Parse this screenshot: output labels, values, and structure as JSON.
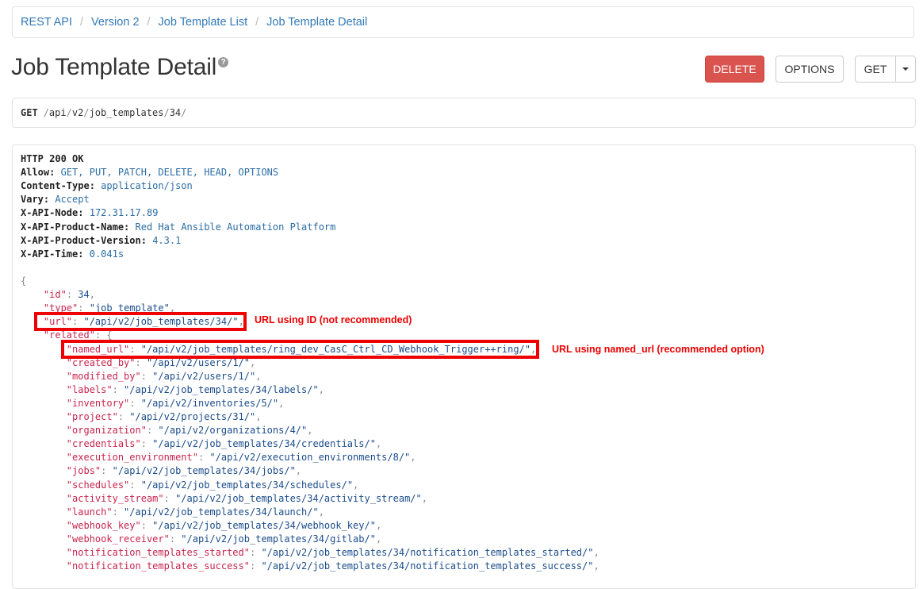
{
  "breadcrumb": [
    "REST API",
    "Version 2",
    "Job Template List",
    "Job Template Detail"
  ],
  "page": {
    "title": "Job Template Detail",
    "help_glyph": "?"
  },
  "toolbar": {
    "delete_label": "DELETE",
    "options_label": "OPTIONS",
    "get_label": "GET"
  },
  "request": {
    "method": "GET",
    "path_segments": [
      "api",
      "v2",
      "job_templates",
      "34"
    ]
  },
  "response": {
    "status": "HTTP 200 OK",
    "headers": [
      {
        "name": "Allow:",
        "value": "GET, PUT, PATCH, DELETE, HEAD, OPTIONS"
      },
      {
        "name": "Content-Type:",
        "value": "application/json"
      },
      {
        "name": "Vary:",
        "value": "Accept"
      },
      {
        "name": "X-API-Node:",
        "value": "172.31.17.89"
      },
      {
        "name": "X-API-Product-Name:",
        "value": "Red Hat Ansible Automation Platform"
      },
      {
        "name": "X-API-Product-Version:",
        "value": "4.3.1"
      },
      {
        "name": "X-API-Time:",
        "value": "0.041s"
      }
    ],
    "json_lines": [
      {
        "t": "brace",
        "text": "{"
      },
      {
        "indent": 1,
        "key": "\"id\"",
        "val": "34",
        "valtype": "num"
      },
      {
        "indent": 1,
        "key": "\"type\"",
        "val": "\"job_template\""
      },
      {
        "indent": 1,
        "key": "\"url\"",
        "val": "\"/api/v2/job_templates/34/\""
      },
      {
        "indent": 1,
        "key": "\"related\"",
        "open": "{"
      },
      {
        "indent": 2,
        "key": "\"named_url\"",
        "val": "\"/api/v2/job_templates/ring_dev_CasC_Ctrl_CD_Webhook_Trigger++ring/\""
      },
      {
        "indent": 2,
        "key": "\"created_by\"",
        "val": "\"/api/v2/users/1/\""
      },
      {
        "indent": 2,
        "key": "\"modified_by\"",
        "val": "\"/api/v2/users/1/\""
      },
      {
        "indent": 2,
        "key": "\"labels\"",
        "val": "\"/api/v2/job_templates/34/labels/\""
      },
      {
        "indent": 2,
        "key": "\"inventory\"",
        "val": "\"/api/v2/inventories/5/\""
      },
      {
        "indent": 2,
        "key": "\"project\"",
        "val": "\"/api/v2/projects/31/\""
      },
      {
        "indent": 2,
        "key": "\"organization\"",
        "val": "\"/api/v2/organizations/4/\""
      },
      {
        "indent": 2,
        "key": "\"credentials\"",
        "val": "\"/api/v2/job_templates/34/credentials/\""
      },
      {
        "indent": 2,
        "key": "\"execution_environment\"",
        "val": "\"/api/v2/execution_environments/8/\""
      },
      {
        "indent": 2,
        "key": "\"jobs\"",
        "val": "\"/api/v2/job_templates/34/jobs/\""
      },
      {
        "indent": 2,
        "key": "\"schedules\"",
        "val": "\"/api/v2/job_templates/34/schedules/\""
      },
      {
        "indent": 2,
        "key": "\"activity_stream\"",
        "val": "\"/api/v2/job_templates/34/activity_stream/\""
      },
      {
        "indent": 2,
        "key": "\"launch\"",
        "val": "\"/api/v2/job_templates/34/launch/\""
      },
      {
        "indent": 2,
        "key": "\"webhook_key\"",
        "val": "\"/api/v2/job_templates/34/webhook_key/\""
      },
      {
        "indent": 2,
        "key": "\"webhook_receiver\"",
        "val": "\"/api/v2/job_templates/34/gitlab/\""
      },
      {
        "indent": 2,
        "key": "\"notification_templates_started\"",
        "val": "\"/api/v2/job_templates/34/notification_templates_started/\""
      },
      {
        "indent": 2,
        "key": "\"notification_templates_success\"",
        "val": "\"/api/v2/job_templates/34/notification_templates_success/\""
      }
    ]
  },
  "annotations": {
    "url_note": "URL using ID (not recommended)",
    "named_url_note": "URL using named_url (recommended option)",
    "color": "#e00000"
  }
}
